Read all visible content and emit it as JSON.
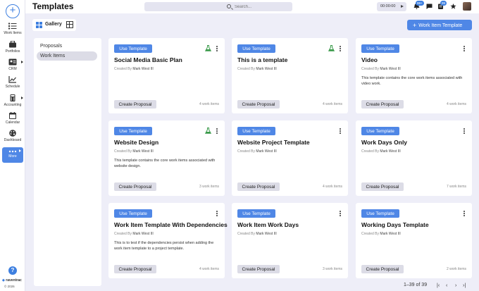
{
  "app": {
    "brand": "raventrac",
    "copyright": "© 2026"
  },
  "header": {
    "title": "Templates"
  },
  "search": {
    "placeholder": "Search..."
  },
  "timer": {
    "value": "00:00:00"
  },
  "badges": {
    "notifications": "99+",
    "tasks": "99"
  },
  "sidebar": {
    "items": [
      {
        "label": "Work Items",
        "icon": "checklist-icon"
      },
      {
        "label": "Portfolios",
        "icon": "briefcase-icon"
      },
      {
        "label": "CRM",
        "icon": "contact-card-icon"
      },
      {
        "label": "Schedule",
        "icon": "chart-line-icon"
      },
      {
        "label": "Accounting",
        "icon": "calculator-icon"
      },
      {
        "label": "Calendar",
        "icon": "calendar-icon"
      },
      {
        "label": "Dashboard",
        "icon": "palette-icon"
      },
      {
        "label": "More",
        "icon": "more-dots-icon"
      }
    ]
  },
  "toolbar": {
    "gallery_label": "Gallery",
    "add_label": "Work Item Template"
  },
  "categories": [
    "Proposals",
    "Work Items"
  ],
  "cards": [
    {
      "title": "Social Media Basic Plan",
      "author": "Mark West III",
      "desc": "",
      "count": "4 work items",
      "flask": true
    },
    {
      "title": "This is a template",
      "author": "Mark West III",
      "desc": "",
      "count": "4 work items",
      "flask": true
    },
    {
      "title": "Video",
      "author": "Mark West III",
      "desc": "This template contains the core work items associated with video work.",
      "count": "4 work items",
      "flask": false
    },
    {
      "title": "Website Design",
      "author": "Mark West III",
      "desc": "This template contains the core work items associated with website design.",
      "count": "3 work items",
      "flask": true
    },
    {
      "title": "Website Project Template",
      "author": "Mark West III",
      "desc": "",
      "count": "4 work items",
      "flask": false
    },
    {
      "title": "Work Days Only",
      "author": "Mark West III",
      "desc": "",
      "count": "7 work items",
      "flask": false
    },
    {
      "title": "Work Item Template With Dependencies",
      "author": "Mark West III",
      "desc": "This is to test if the dependencies persist when adding the work item template to a project template.",
      "count": "4 work items",
      "flask": false
    },
    {
      "title": "Work Item Work Days",
      "author": "Mark West III",
      "desc": "",
      "count": "3 work items",
      "flask": false
    },
    {
      "title": "Working Days Template",
      "author": "Mark West III",
      "desc": "",
      "count": "2 work items",
      "flask": false
    }
  ],
  "card_labels": {
    "use": "Use Template",
    "created_by": "Created By",
    "create_proposal": "Create Proposal"
  },
  "pagination": {
    "range": "1–39 of 39"
  }
}
